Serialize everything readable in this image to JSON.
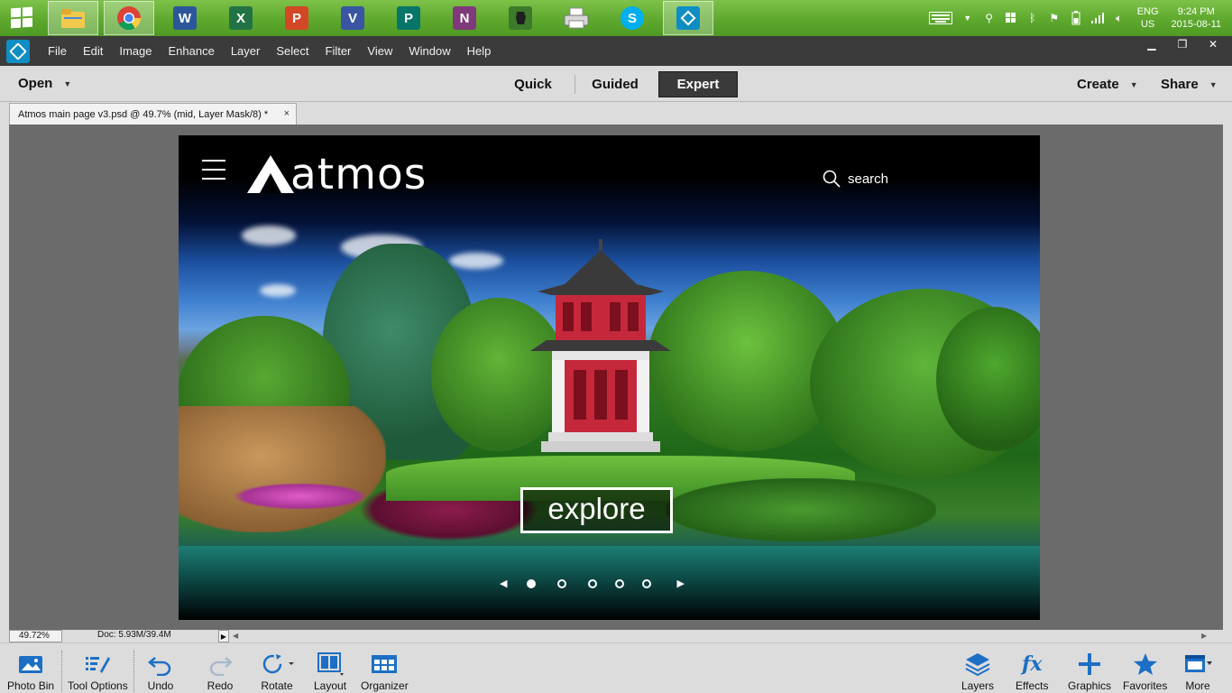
{
  "taskbar": {
    "apps": [
      {
        "name": "file-explorer",
        "active": true
      },
      {
        "name": "chrome",
        "active": true
      },
      {
        "name": "word",
        "letter": "W",
        "color": "#2b579a"
      },
      {
        "name": "excel",
        "letter": "X",
        "color": "#217346"
      },
      {
        "name": "powerpoint",
        "letter": "P",
        "color": "#d24726"
      },
      {
        "name": "visio",
        "letter": "V",
        "color": "#3955a3"
      },
      {
        "name": "publisher",
        "letter": "P",
        "color": "#077568"
      },
      {
        "name": "onenote",
        "letter": "N",
        "color": "#80397b"
      },
      {
        "name": "evernote"
      },
      {
        "name": "fax-printer"
      },
      {
        "name": "skype",
        "letter": "S",
        "color": "#00aff0"
      },
      {
        "name": "photoshop-elements",
        "active": true
      }
    ],
    "tray": {
      "lang_top": "ENG",
      "lang_bottom": "US",
      "time": "9:24 PM",
      "date": "2015-08-11"
    }
  },
  "menubar": {
    "items": [
      "File",
      "Edit",
      "Image",
      "Enhance",
      "Layer",
      "Select",
      "Filter",
      "View",
      "Window",
      "Help"
    ]
  },
  "modebar": {
    "open_label": "Open",
    "modes": [
      {
        "label": "Quick",
        "active": false
      },
      {
        "label": "Guided",
        "active": false
      },
      {
        "label": "Expert",
        "active": true
      }
    ],
    "create_label": "Create",
    "share_label": "Share"
  },
  "document": {
    "tab_title": "Atmos main page v3.psd @ 49.7% (mid, Layer Mask/8) *",
    "close_glyph": "×"
  },
  "canvas": {
    "brand": "atmos",
    "search_label": "search",
    "cta_label": "explore",
    "slider": {
      "count": 5,
      "active_index": 0
    }
  },
  "status": {
    "zoom": "49.72%",
    "doc_info": "Doc: 5.93M/39.4M"
  },
  "bottom_left": [
    {
      "label": "Photo Bin",
      "icon": "photo-bin-icon"
    },
    {
      "label": "Tool Options",
      "icon": "tool-options-icon"
    },
    {
      "label": "Undo",
      "icon": "undo-icon"
    },
    {
      "label": "Redo",
      "icon": "redo-icon"
    },
    {
      "label": "Rotate",
      "icon": "rotate-icon"
    },
    {
      "label": "Layout",
      "icon": "layout-icon"
    },
    {
      "label": "Organizer",
      "icon": "organizer-icon"
    }
  ],
  "bottom_right": [
    {
      "label": "Layers",
      "icon": "layers-icon"
    },
    {
      "label": "Effects",
      "icon": "effects-icon"
    },
    {
      "label": "Graphics",
      "icon": "graphics-icon"
    },
    {
      "label": "Favorites",
      "icon": "favorites-icon"
    },
    {
      "label": "More",
      "icon": "more-icon"
    }
  ],
  "colors": {
    "taskbar_green": "#5ea82e",
    "menubar_bg": "#3b3b3b",
    "panel_bg": "#dcdcdc",
    "workspace_bg": "#6b6b6b",
    "accent_blue": "#1c6fc4"
  }
}
